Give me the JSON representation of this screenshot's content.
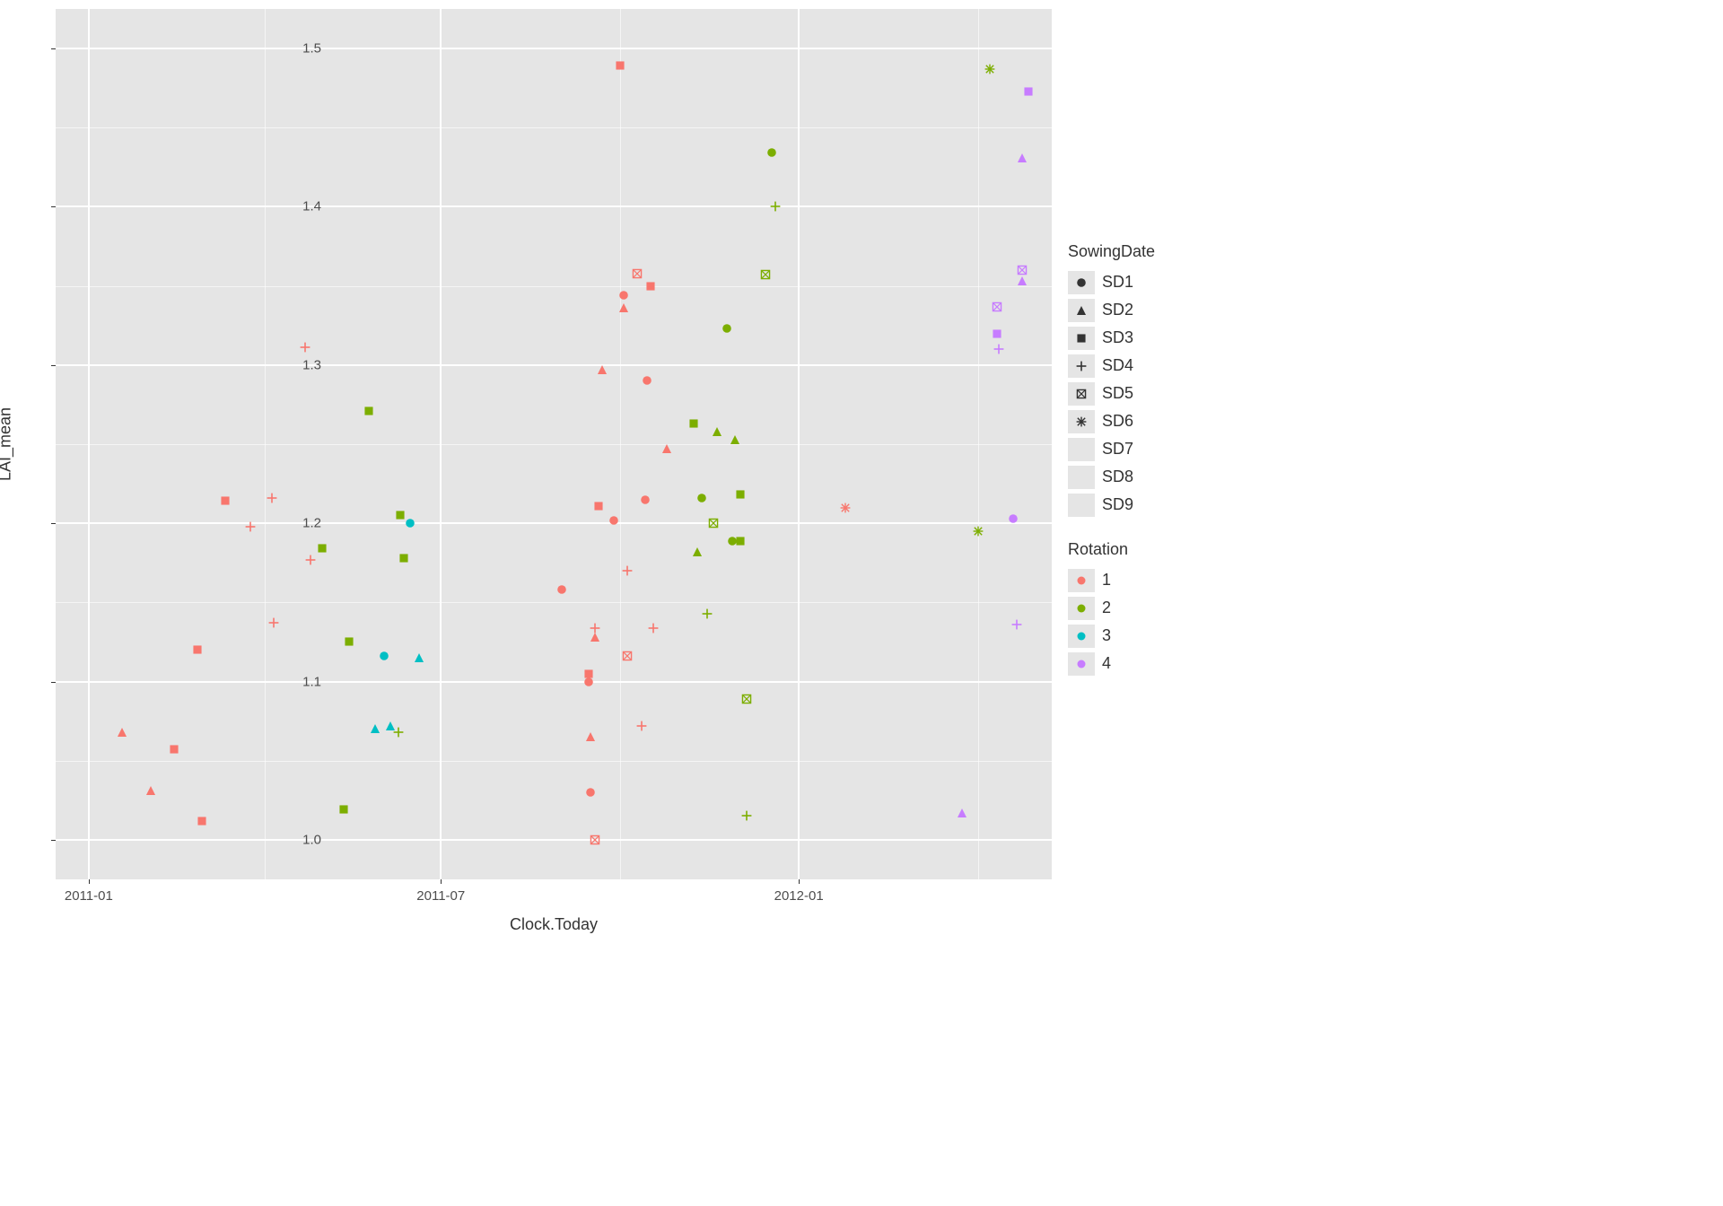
{
  "chart_data": {
    "type": "scatter",
    "xlabel": "Clock.Today",
    "ylabel": "LAI_mean",
    "x_is_date": true,
    "x_ticks": [
      "2011-01",
      "2011-07",
      "2012-01"
    ],
    "y_ticks": [
      1.0,
      1.1,
      1.2,
      1.3,
      1.4,
      1.5
    ],
    "ylim": [
      0.975,
      1.525
    ],
    "xlim_dates": [
      "2010-12-15",
      "2012-05-10"
    ],
    "shape_legend": {
      "title": "SowingDate",
      "items": [
        "SD1",
        "SD2",
        "SD3",
        "SD4",
        "SD5",
        "SD6",
        "SD7",
        "SD8",
        "SD9"
      ]
    },
    "color_legend": {
      "title": "Rotation",
      "items": [
        {
          "label": "1",
          "color": "#F8766D"
        },
        {
          "label": "2",
          "color": "#7CAE00"
        },
        {
          "label": "3",
          "color": "#00BFC4"
        },
        {
          "label": "4",
          "color": "#C77CFF"
        }
      ]
    },
    "points": [
      {
        "date": "2011-01-18",
        "y": 1.068,
        "shape": "SD2",
        "rotation": "1"
      },
      {
        "date": "2011-02-02",
        "y": 1.031,
        "shape": "SD2",
        "rotation": "1"
      },
      {
        "date": "2011-02-14",
        "y": 1.057,
        "shape": "SD3",
        "rotation": "1"
      },
      {
        "date": "2011-02-26",
        "y": 1.12,
        "shape": "SD3",
        "rotation": "1"
      },
      {
        "date": "2011-02-28",
        "y": 1.012,
        "shape": "SD3",
        "rotation": "1"
      },
      {
        "date": "2011-03-12",
        "y": 1.214,
        "shape": "SD3",
        "rotation": "1"
      },
      {
        "date": "2011-03-25",
        "y": 1.198,
        "shape": "SD4",
        "rotation": "1"
      },
      {
        "date": "2011-04-05",
        "y": 1.216,
        "shape": "SD4",
        "rotation": "1"
      },
      {
        "date": "2011-04-06",
        "y": 1.137,
        "shape": "SD4",
        "rotation": "1"
      },
      {
        "date": "2011-04-22",
        "y": 1.311,
        "shape": "SD4",
        "rotation": "1"
      },
      {
        "date": "2011-04-25",
        "y": 1.177,
        "shape": "SD4",
        "rotation": "1"
      },
      {
        "date": "2011-05-01",
        "y": 1.184,
        "shape": "SD3",
        "rotation": "2"
      },
      {
        "date": "2011-05-12",
        "y": 1.019,
        "shape": "SD3",
        "rotation": "2"
      },
      {
        "date": "2011-05-15",
        "y": 1.125,
        "shape": "SD3",
        "rotation": "2"
      },
      {
        "date": "2011-05-25",
        "y": 1.271,
        "shape": "SD3",
        "rotation": "2"
      },
      {
        "date": "2011-05-28",
        "y": 1.07,
        "shape": "SD2",
        "rotation": "3"
      },
      {
        "date": "2011-06-02",
        "y": 1.116,
        "shape": "SD1",
        "rotation": "3"
      },
      {
        "date": "2011-06-05",
        "y": 1.072,
        "shape": "SD2",
        "rotation": "3"
      },
      {
        "date": "2011-06-09",
        "y": 1.068,
        "shape": "SD4",
        "rotation": "2"
      },
      {
        "date": "2011-06-10",
        "y": 1.205,
        "shape": "SD3",
        "rotation": "2"
      },
      {
        "date": "2011-06-12",
        "y": 1.178,
        "shape": "SD3",
        "rotation": "2"
      },
      {
        "date": "2011-06-15",
        "y": 1.2,
        "shape": "SD1",
        "rotation": "3"
      },
      {
        "date": "2011-06-20",
        "y": 1.115,
        "shape": "SD2",
        "rotation": "3"
      },
      {
        "date": "2011-09-01",
        "y": 1.158,
        "shape": "SD1",
        "rotation": "1"
      },
      {
        "date": "2011-09-15",
        "y": 1.1,
        "shape": "SD1",
        "rotation": "1"
      },
      {
        "date": "2011-09-15",
        "y": 1.105,
        "shape": "SD3",
        "rotation": "1"
      },
      {
        "date": "2011-09-16",
        "y": 1.03,
        "shape": "SD1",
        "rotation": "1"
      },
      {
        "date": "2011-09-16",
        "y": 1.065,
        "shape": "SD2",
        "rotation": "1"
      },
      {
        "date": "2011-09-18",
        "y": 1.128,
        "shape": "SD2",
        "rotation": "1"
      },
      {
        "date": "2011-09-18",
        "y": 1.134,
        "shape": "SD4",
        "rotation": "1"
      },
      {
        "date": "2011-09-18",
        "y": 1.0,
        "shape": "SD5",
        "rotation": "1"
      },
      {
        "date": "2011-09-20",
        "y": 1.211,
        "shape": "SD3",
        "rotation": "1"
      },
      {
        "date": "2011-09-22",
        "y": 1.297,
        "shape": "SD2",
        "rotation": "1"
      },
      {
        "date": "2011-09-28",
        "y": 1.202,
        "shape": "SD1",
        "rotation": "1"
      },
      {
        "date": "2011-10-01",
        "y": 1.489,
        "shape": "SD3",
        "rotation": "1"
      },
      {
        "date": "2011-10-03",
        "y": 1.336,
        "shape": "SD2",
        "rotation": "1"
      },
      {
        "date": "2011-10-03",
        "y": 1.344,
        "shape": "SD1",
        "rotation": "1"
      },
      {
        "date": "2011-10-05",
        "y": 1.116,
        "shape": "SD5",
        "rotation": "1"
      },
      {
        "date": "2011-10-05",
        "y": 1.17,
        "shape": "SD4",
        "rotation": "1"
      },
      {
        "date": "2011-10-10",
        "y": 1.358,
        "shape": "SD5",
        "rotation": "1"
      },
      {
        "date": "2011-10-12",
        "y": 1.072,
        "shape": "SD4",
        "rotation": "1"
      },
      {
        "date": "2011-10-14",
        "y": 1.215,
        "shape": "SD1",
        "rotation": "1"
      },
      {
        "date": "2011-10-15",
        "y": 1.29,
        "shape": "SD1",
        "rotation": "1"
      },
      {
        "date": "2011-10-17",
        "y": 1.35,
        "shape": "SD3",
        "rotation": "1"
      },
      {
        "date": "2011-10-18",
        "y": 1.134,
        "shape": "SD4",
        "rotation": "1"
      },
      {
        "date": "2011-10-25",
        "y": 1.247,
        "shape": "SD2",
        "rotation": "1"
      },
      {
        "date": "2011-11-08",
        "y": 1.263,
        "shape": "SD3",
        "rotation": "2"
      },
      {
        "date": "2011-11-10",
        "y": 1.182,
        "shape": "SD2",
        "rotation": "2"
      },
      {
        "date": "2011-11-12",
        "y": 1.216,
        "shape": "SD1",
        "rotation": "2"
      },
      {
        "date": "2011-11-15",
        "y": 1.143,
        "shape": "SD4",
        "rotation": "2"
      },
      {
        "date": "2011-11-18",
        "y": 1.2,
        "shape": "SD5",
        "rotation": "2"
      },
      {
        "date": "2011-11-20",
        "y": 1.258,
        "shape": "SD2",
        "rotation": "2"
      },
      {
        "date": "2011-11-25",
        "y": 1.323,
        "shape": "SD1",
        "rotation": "2"
      },
      {
        "date": "2011-11-28",
        "y": 1.189,
        "shape": "SD1",
        "rotation": "2"
      },
      {
        "date": "2011-11-29",
        "y": 1.253,
        "shape": "SD2",
        "rotation": "2"
      },
      {
        "date": "2011-12-02",
        "y": 1.218,
        "shape": "SD3",
        "rotation": "2"
      },
      {
        "date": "2011-12-02",
        "y": 1.189,
        "shape": "SD3",
        "rotation": "2"
      },
      {
        "date": "2011-12-05",
        "y": 1.015,
        "shape": "SD4",
        "rotation": "2"
      },
      {
        "date": "2011-12-05",
        "y": 1.089,
        "shape": "SD5",
        "rotation": "2"
      },
      {
        "date": "2011-12-15",
        "y": 1.357,
        "shape": "SD5",
        "rotation": "2"
      },
      {
        "date": "2011-12-18",
        "y": 1.434,
        "shape": "SD1",
        "rotation": "2"
      },
      {
        "date": "2011-12-20",
        "y": 1.4,
        "shape": "SD4",
        "rotation": "2"
      },
      {
        "date": "2012-01-25",
        "y": 1.21,
        "shape": "SD6",
        "rotation": "1"
      },
      {
        "date": "2012-03-25",
        "y": 1.017,
        "shape": "SD2",
        "rotation": "4"
      },
      {
        "date": "2012-04-02",
        "y": 1.195,
        "shape": "SD6",
        "rotation": "2"
      },
      {
        "date": "2012-04-08",
        "y": 1.487,
        "shape": "SD6",
        "rotation": "2"
      },
      {
        "date": "2012-04-12",
        "y": 1.32,
        "shape": "SD3",
        "rotation": "4"
      },
      {
        "date": "2012-04-12",
        "y": 1.337,
        "shape": "SD5",
        "rotation": "4"
      },
      {
        "date": "2012-04-13",
        "y": 1.31,
        "shape": "SD4",
        "rotation": "4"
      },
      {
        "date": "2012-04-20",
        "y": 1.203,
        "shape": "SD1",
        "rotation": "4"
      },
      {
        "date": "2012-04-22",
        "y": 1.136,
        "shape": "SD4",
        "rotation": "4"
      },
      {
        "date": "2012-04-25",
        "y": 1.353,
        "shape": "SD2",
        "rotation": "4"
      },
      {
        "date": "2012-04-25",
        "y": 1.36,
        "shape": "SD5",
        "rotation": "4"
      },
      {
        "date": "2012-04-25",
        "y": 1.431,
        "shape": "SD2",
        "rotation": "4"
      },
      {
        "date": "2012-04-28",
        "y": 1.473,
        "shape": "SD3",
        "rotation": "4"
      }
    ]
  }
}
